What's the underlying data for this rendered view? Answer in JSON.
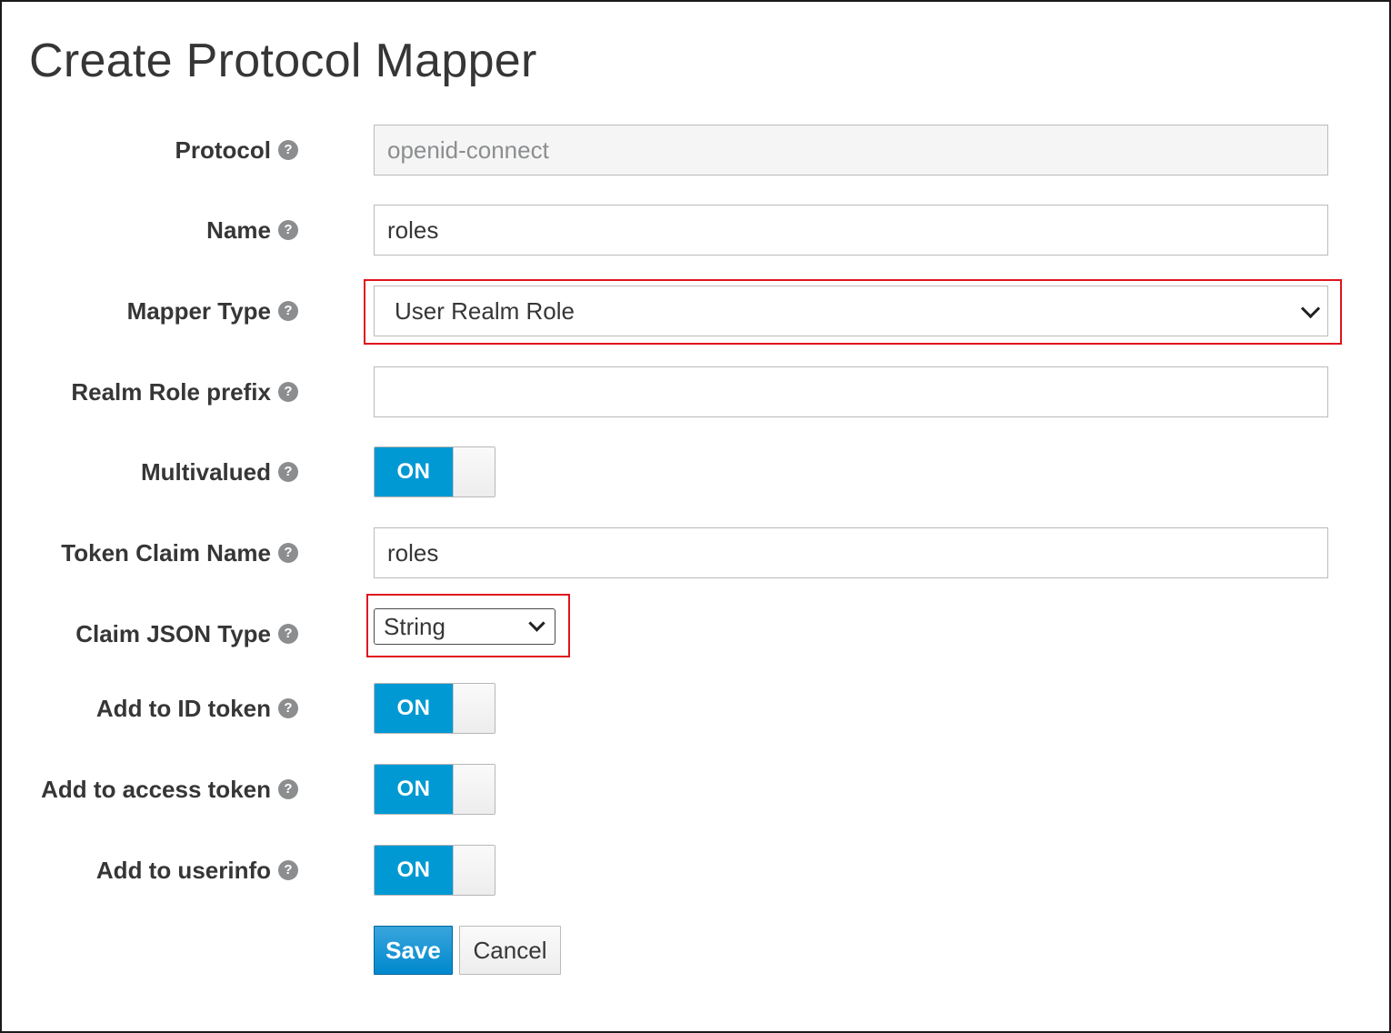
{
  "page": {
    "title": "Create Protocol Mapper"
  },
  "form": {
    "protocol": {
      "label": "Protocol",
      "value": "openid-connect"
    },
    "name": {
      "label": "Name",
      "value": "roles"
    },
    "mapper_type": {
      "label": "Mapper Type",
      "selected": "User Realm Role"
    },
    "realm_role_prefix": {
      "label": "Realm Role prefix",
      "value": ""
    },
    "multivalued": {
      "label": "Multivalued",
      "state": "ON"
    },
    "token_claim_name": {
      "label": "Token Claim Name",
      "value": "roles"
    },
    "claim_json_type": {
      "label": "Claim JSON Type",
      "selected": "String"
    },
    "add_to_id_token": {
      "label": "Add to ID token",
      "state": "ON"
    },
    "add_to_access_token": {
      "label": "Add to access token",
      "state": "ON"
    },
    "add_to_userinfo": {
      "label": "Add to userinfo",
      "state": "ON"
    }
  },
  "actions": {
    "save_label": "Save",
    "cancel_label": "Cancel"
  },
  "colors": {
    "toggle_on": "#0099d3",
    "primary_button": "#0088ce",
    "highlight_border": "#e0141e"
  },
  "icons": {
    "help": "question-circle-icon",
    "dropdown": "chevron-down-icon"
  }
}
